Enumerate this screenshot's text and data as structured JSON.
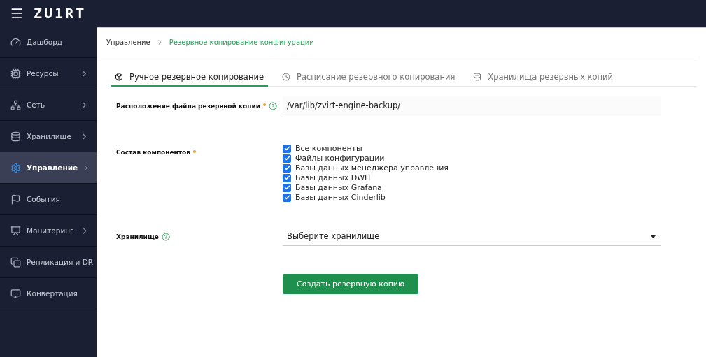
{
  "topbar": {
    "logo": "ZU1RT"
  },
  "sidebar": {
    "items": [
      {
        "label": "Дашборд",
        "selected": false,
        "expandable": false
      },
      {
        "label": "Ресурсы",
        "selected": false,
        "expandable": true
      },
      {
        "label": "Сеть",
        "selected": false,
        "expandable": true
      },
      {
        "label": "Хранилище",
        "selected": false,
        "expandable": true
      },
      {
        "label": "Управление",
        "selected": true,
        "expandable": true
      },
      {
        "label": "События",
        "selected": false,
        "expandable": false
      },
      {
        "label": "Мониторинг",
        "selected": false,
        "expandable": true
      },
      {
        "label": "Репликация и DR",
        "selected": false,
        "expandable": false
      },
      {
        "label": "Конвертация",
        "selected": false,
        "expandable": false
      }
    ]
  },
  "breadcrumb": [
    "Управление",
    "Резервное копирование конфигурации"
  ],
  "tabs": [
    {
      "label": "Ручное резервное копирование",
      "selected": true
    },
    {
      "label": "Расписание резервного копирования",
      "selected": false
    },
    {
      "label": "Хранилища резервных копий",
      "selected": false
    }
  ],
  "form": {
    "location": {
      "label": "Расположение файла резервной копии",
      "required": true,
      "help": true,
      "value": "/var/lib/zvirt-engine-backup/"
    },
    "components": {
      "label": "Состав компонентов",
      "required": true,
      "options": [
        {
          "label": "Все компоненты",
          "checked": true
        },
        {
          "label": "Файлы конфигурации",
          "checked": true
        },
        {
          "label": "Базы данных менеджера управления",
          "checked": true
        },
        {
          "label": "Базы данных DWH",
          "checked": true
        },
        {
          "label": "Базы данных Grafana",
          "checked": true
        },
        {
          "label": "Базы данных Cinderlib",
          "checked": true
        }
      ]
    },
    "storage": {
      "label": "Хранилище",
      "help": true,
      "placeholder": "Выберите хранилище"
    },
    "submit": "Создать резервную копию"
  }
}
